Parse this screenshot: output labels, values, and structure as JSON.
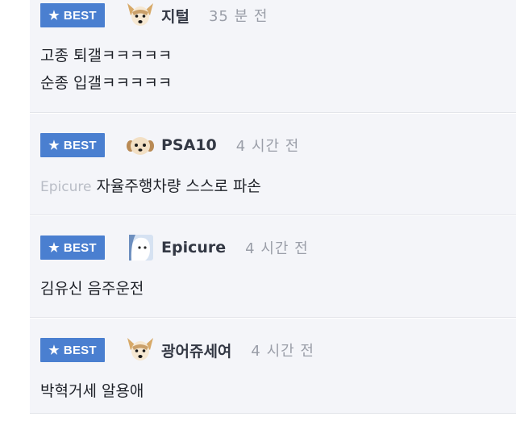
{
  "badge_label": "BEST",
  "badge_icon": "star-icon",
  "colors": {
    "badge_bg": "#4a7fd0",
    "card_bg": "#f4f5f9",
    "nick": "#333844",
    "time": "#9a9ea8",
    "mention": "#b9bdc6"
  },
  "comments": [
    {
      "avatar": "dog-avatar-icon",
      "nickname": "지털",
      "time": "35 분 전",
      "lines": [
        "고종 퇴갤ㅋㅋㅋㅋㅋ",
        "순종 입갤ㅋㅋㅋㅋㅋ"
      ]
    },
    {
      "avatar": "puppy-avatar-icon",
      "nickname": "PSA10",
      "time": "4 시간 전",
      "mention": "Epicure",
      "lines": [
        "자율주행차량 스스로 파손"
      ]
    },
    {
      "avatar": "white-creature-avatar-icon",
      "nickname": "Epicure",
      "time": "4 시간 전",
      "lines": [
        "김유신 음주운전"
      ]
    },
    {
      "avatar": "dog-avatar-icon",
      "nickname": "광어쥬세여",
      "time": "4 시간 전",
      "lines": [
        "박혁거세 알용애"
      ]
    }
  ]
}
